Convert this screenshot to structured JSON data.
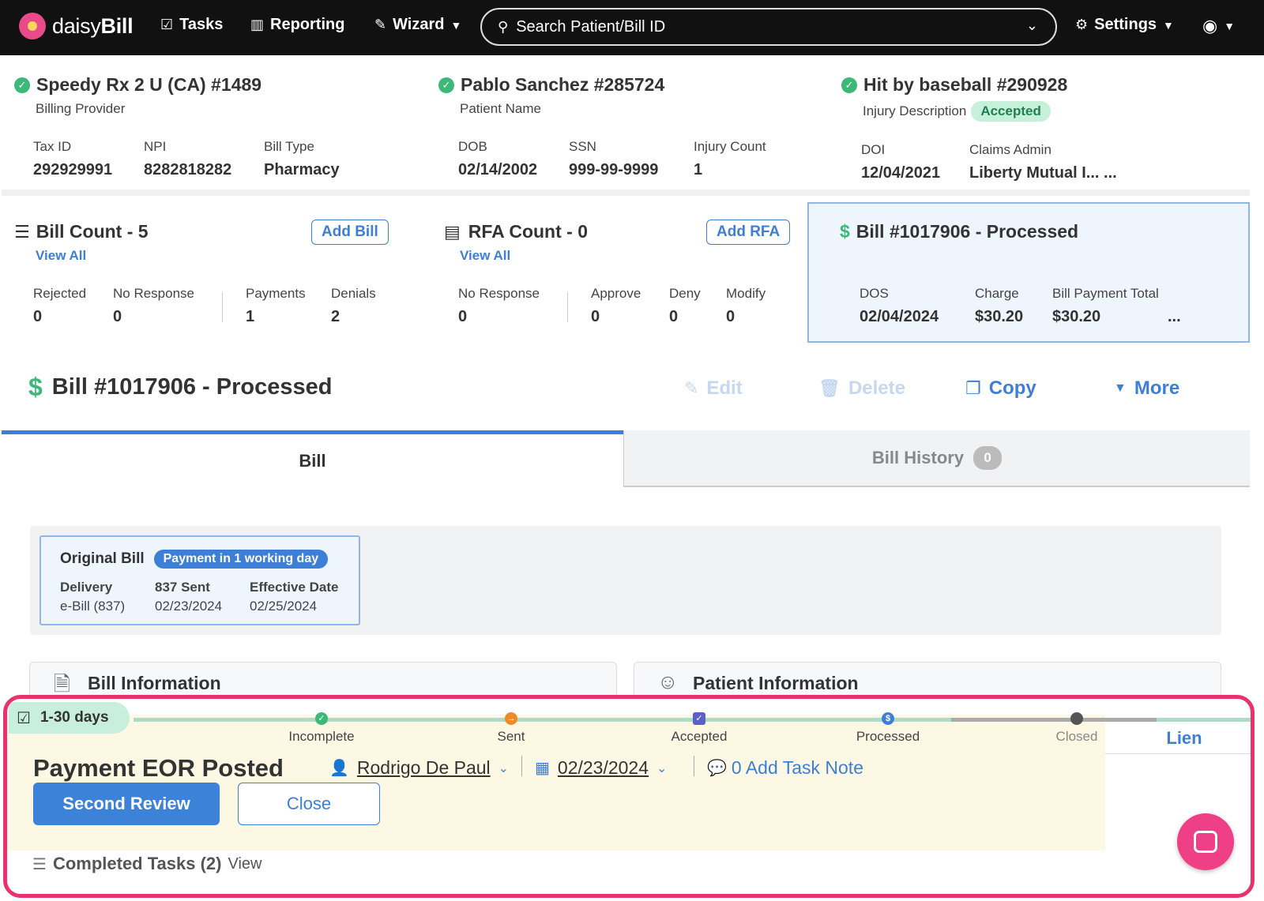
{
  "nav": {
    "brand_light": "daisy",
    "brand_bold": "Bill",
    "tasks": "Tasks",
    "reporting": "Reporting",
    "wizard": "Wizard",
    "search_placeholder": "Search Patient/Bill ID",
    "settings": "Settings"
  },
  "provider": {
    "title": "Speedy Rx 2 U (CA) #1489",
    "subtitle": "Billing Provider",
    "tax_id_label": "Tax ID",
    "tax_id": "292929991",
    "npi_label": "NPI",
    "npi": "8282818282",
    "bill_type_label": "Bill Type",
    "bill_type": "Pharmacy"
  },
  "patient": {
    "title": "Pablo Sanchez #285724",
    "subtitle": "Patient Name",
    "dob_label": "DOB",
    "dob": "02/14/2002",
    "ssn_label": "SSN",
    "ssn": "999-99-9999",
    "injury_count_label": "Injury Count",
    "injury_count": "1"
  },
  "injury": {
    "title": "Hit by baseball #290928",
    "subtitle": "Injury Description",
    "status": "Accepted",
    "doi_label": "DOI",
    "doi": "12/04/2021",
    "claims_admin_label": "Claims Admin",
    "claims_admin": "Liberty Mutual I... ..."
  },
  "bill_count": {
    "title": "Bill Count - 5",
    "add": "Add Bill",
    "view_all": "View All",
    "rejected_label": "Rejected",
    "rejected": "0",
    "no_response_label": "No Response",
    "no_response": "0",
    "payments_label": "Payments",
    "payments": "1",
    "denials_label": "Denials",
    "denials": "2"
  },
  "rfa_count": {
    "title": "RFA Count - 0",
    "add": "Add RFA",
    "view_all": "View All",
    "no_response_label": "No Response",
    "no_response": "0",
    "approve_label": "Approve",
    "approve": "0",
    "deny_label": "Deny",
    "deny": "0",
    "modify_label": "Modify",
    "modify": "0"
  },
  "bill_summary": {
    "title": "Bill #1017906 - Processed",
    "dos_label": "DOS",
    "dos": "02/04/2024",
    "charge_label": "Charge",
    "charge": "$30.20",
    "payment_total_label": "Bill Payment Total",
    "payment_total": "$30.20",
    "more": "..."
  },
  "bill_header": {
    "title": "Bill #1017906 - Processed",
    "edit": "Edit",
    "delete": "Delete",
    "copy": "Copy",
    "more": "More"
  },
  "tabs": {
    "bill": "Bill",
    "history": "Bill History",
    "history_count": "0"
  },
  "original_bill": {
    "title": "Original Bill",
    "badge": "Payment in 1 working day",
    "delivery_label": "Delivery",
    "delivery": "e-Bill (837)",
    "sent_label": "837 Sent",
    "sent": "02/23/2024",
    "effective_label": "Effective Date",
    "effective": "02/25/2024"
  },
  "sections": {
    "bill_info": "Bill Information",
    "patient_info": "Patient Information"
  },
  "task": {
    "days": "1-30 days",
    "steps": [
      "Incomplete",
      "Sent",
      "Accepted",
      "Processed",
      "Closed"
    ],
    "title": "Payment EOR Posted",
    "assignee": "Rodrigo De Paul",
    "date": "02/23/2024",
    "note": "0 Add Task Note",
    "primary_btn": "Second Review",
    "close_btn": "Close",
    "lien": "Lien",
    "completed_label": "Completed Tasks (2)",
    "completed_view": "View"
  },
  "colors": {
    "accent": "#3d7fd6",
    "success": "#3cb878",
    "highlight_frame": "#e8336d",
    "task_bg": "#fdf8e4"
  }
}
